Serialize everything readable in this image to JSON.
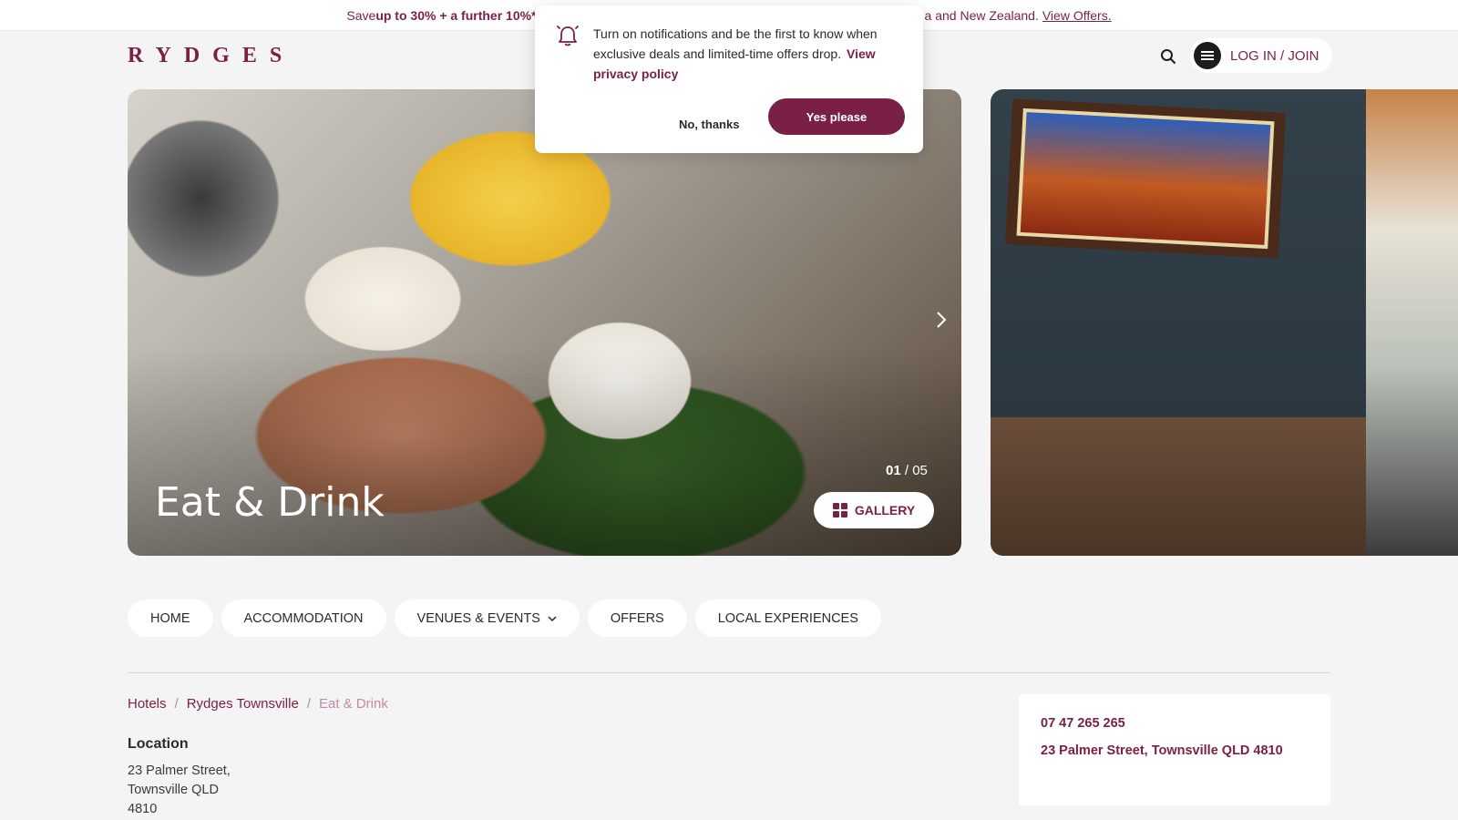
{
  "promo": {
    "prefix": "Save ",
    "bold": "up to 30% + a further 10%*",
    "suffix": "a and New Zealand.",
    "link": "View Offers."
  },
  "header": {
    "logo": "RYDGES",
    "search_icon": "search-icon",
    "login_label": "LOG IN / JOIN",
    "login_icon": "menu-icon"
  },
  "notification": {
    "message": "Turn on notifications and be the first to know when exclusive deals and limited-time offers drop.",
    "privacy_link": "View privacy policy",
    "no_label": "No, thanks",
    "yes_label": "Yes please",
    "icon": "bell-icon"
  },
  "hero": {
    "title": "Eat & Drink",
    "counter_current": "01",
    "counter_sep": " / ",
    "counter_total": "05",
    "gallery_label": "GALLERY",
    "next_icon": "chevron-right-icon"
  },
  "nav": {
    "items": [
      {
        "label": "HOME"
      },
      {
        "label": "ACCOMMODATION"
      },
      {
        "label": "VENUES & EVENTS",
        "has_dropdown": true
      },
      {
        "label": "OFFERS"
      },
      {
        "label": "LOCAL EXPERIENCES"
      }
    ]
  },
  "breadcrumb": {
    "items": [
      "Hotels",
      "Rydges Townsville",
      "Eat & Drink"
    ],
    "separator": "/"
  },
  "location": {
    "title": "Location",
    "lines": [
      "23 Palmer Street,",
      "Townsville QLD",
      "4810"
    ]
  },
  "contact": {
    "phone": "07 47 265 265",
    "address": "23 Palmer Street, Townsville QLD 4810"
  },
  "colors": {
    "brand": "#7a1f45",
    "background": "#f4f4f4",
    "card": "#ffffff"
  }
}
